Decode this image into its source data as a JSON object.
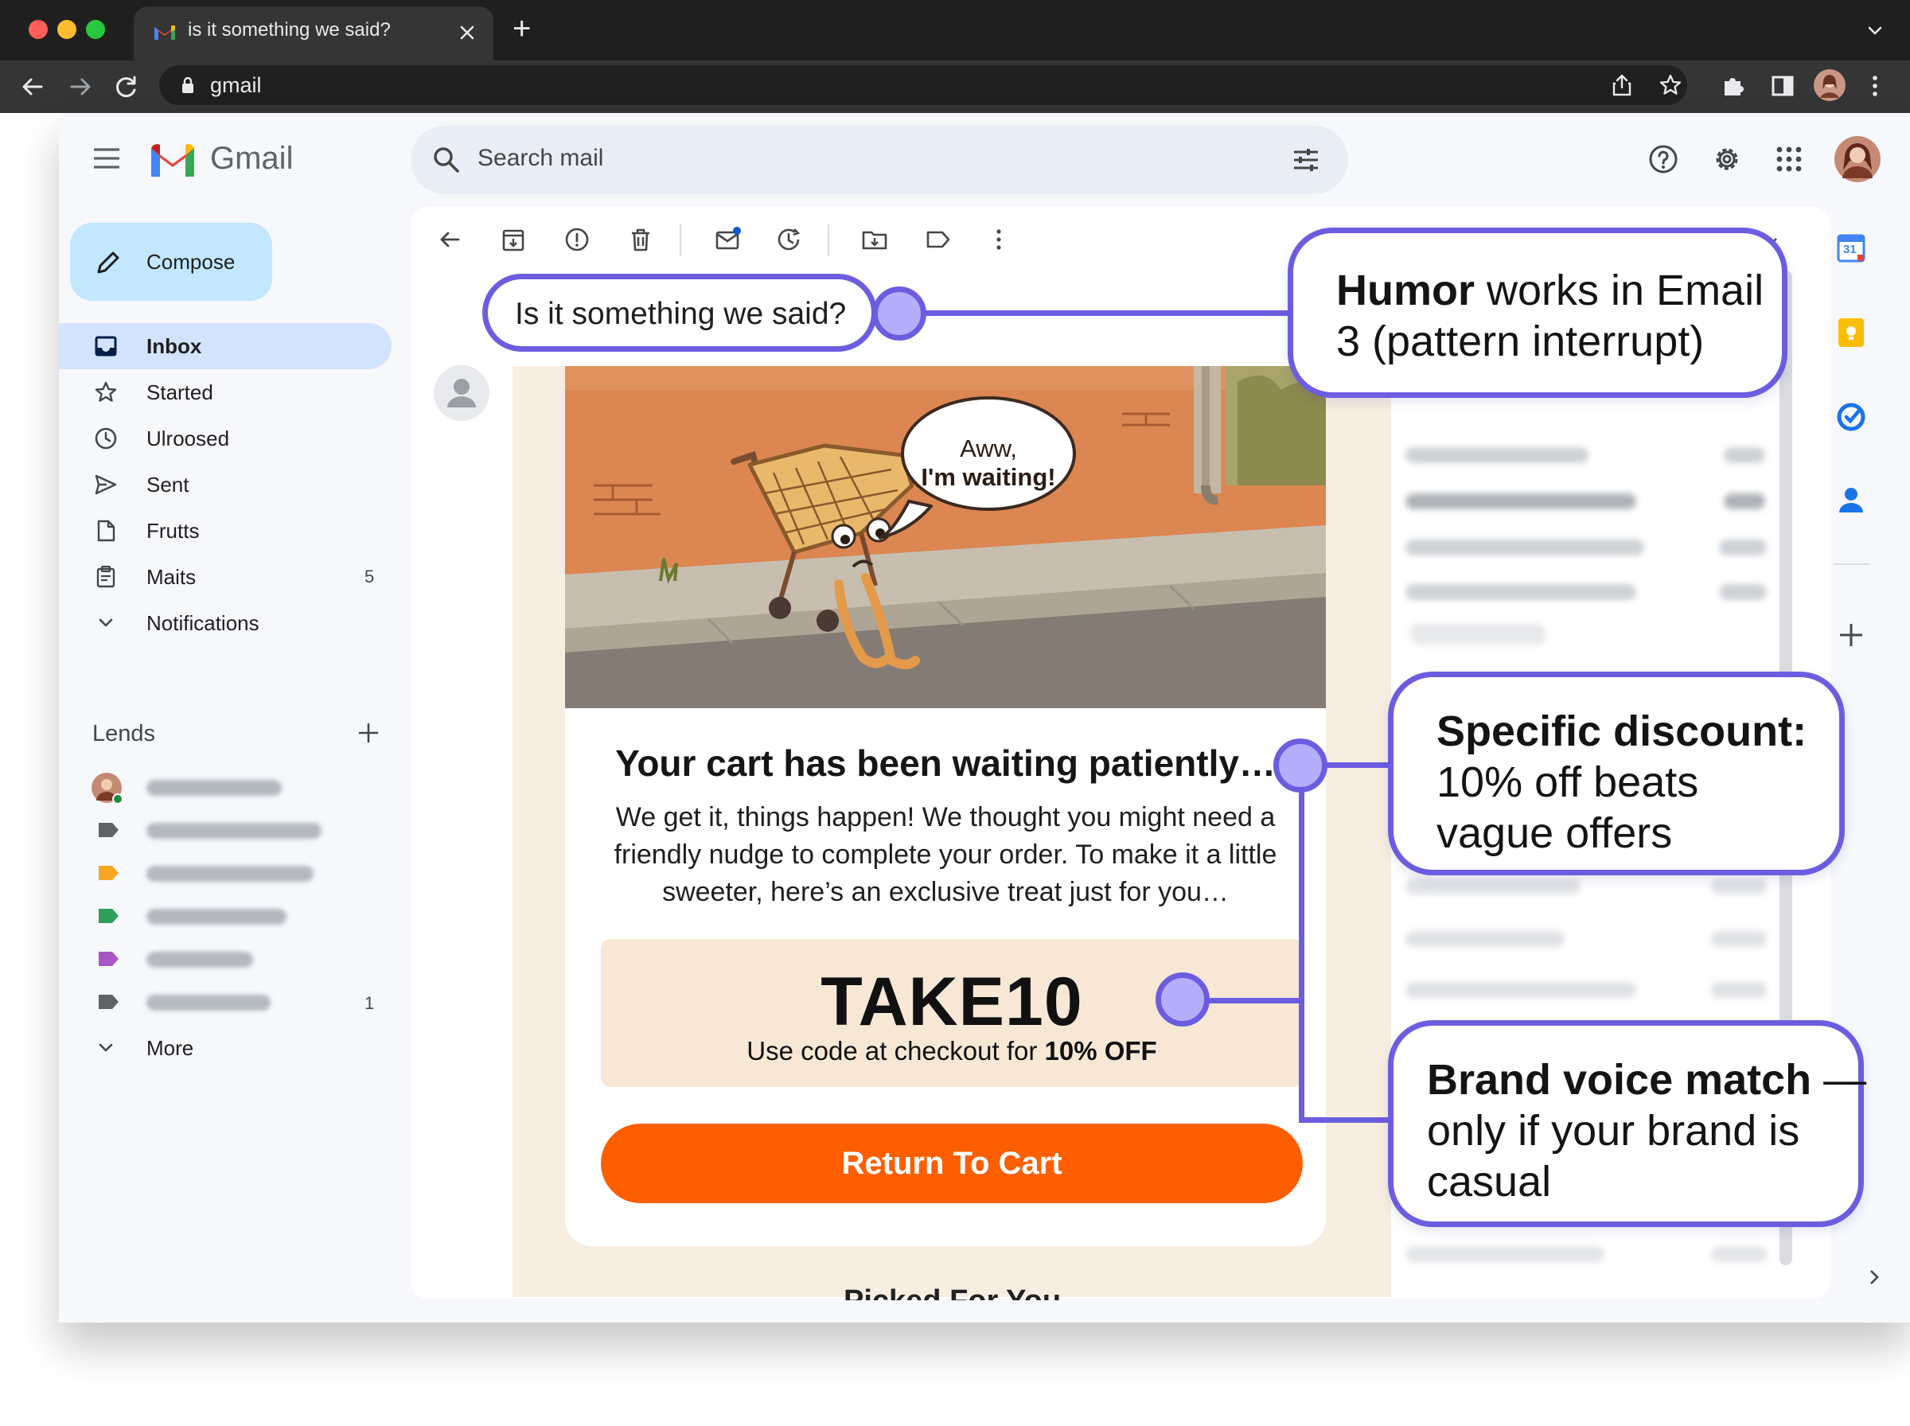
{
  "browser": {
    "tab_title": "is it something we said?",
    "address": "gmail",
    "new_tab_symbol": "+"
  },
  "gmail": {
    "logo_text": "Gmail",
    "search_placeholder": "Search mail",
    "compose_label": "Compose",
    "nav": [
      {
        "label": "Inbox",
        "icon": "inbox-icon",
        "count": ""
      },
      {
        "label": "Started",
        "icon": "star-icon",
        "count": ""
      },
      {
        "label": "Ulroosed",
        "icon": "clock-icon",
        "count": ""
      },
      {
        "label": "Sent",
        "icon": "send-icon",
        "count": ""
      },
      {
        "label": "Frutts",
        "icon": "draft-icon",
        "count": ""
      },
      {
        "label": "Maits",
        "icon": "clipboard-icon",
        "count": "5"
      },
      {
        "label": "Notifications",
        "icon": "chevron-down-icon",
        "count": ""
      }
    ],
    "labels_heading": "Lends",
    "label_rows": [
      {
        "color": "#5f6368",
        "count": ""
      },
      {
        "color": "#f6a623",
        "count": ""
      },
      {
        "color": "#2e9e5b",
        "count": ""
      },
      {
        "color": "#a855c8",
        "count": ""
      },
      {
        "color": "#5f6368",
        "count": "1"
      }
    ],
    "more_label": "More",
    "calendar_day": "31"
  },
  "email": {
    "subject": "Is it something we said?",
    "speech_bubble_line1": "Aww,",
    "speech_bubble_line2": "I'm waiting!",
    "headline": "Your cart has been waiting patiently…",
    "body": "We get it, things happen! We thought you might need a friendly nudge to complete your order. To make it a little sweeter, here’s an exclusive treat just for you…",
    "code": "TAKE10",
    "code_note_prefix": "Use code at checkout for ",
    "code_note_bold": "10% OFF",
    "cta_label": "Return To Cart",
    "next_section_title": "Picked For You"
  },
  "callouts": {
    "humor_bold": "Humor",
    "humor_rest_line1": " works in Email",
    "humor_line2": "3 (pattern interrupt)",
    "discount_bold": "Specific discount:",
    "discount_line2": "10% off beats",
    "discount_line3": "vague offers",
    "brand_bold": "Brand voice match",
    "brand_dash": " —",
    "brand_line2": "only if your brand is",
    "brand_line3": "casual"
  },
  "colors": {
    "accent_purple": "#6c5de0",
    "cta_orange": "#fd5f00",
    "compose_blue": "#c2e7ff",
    "inbox_active": "#d3e3fd"
  }
}
